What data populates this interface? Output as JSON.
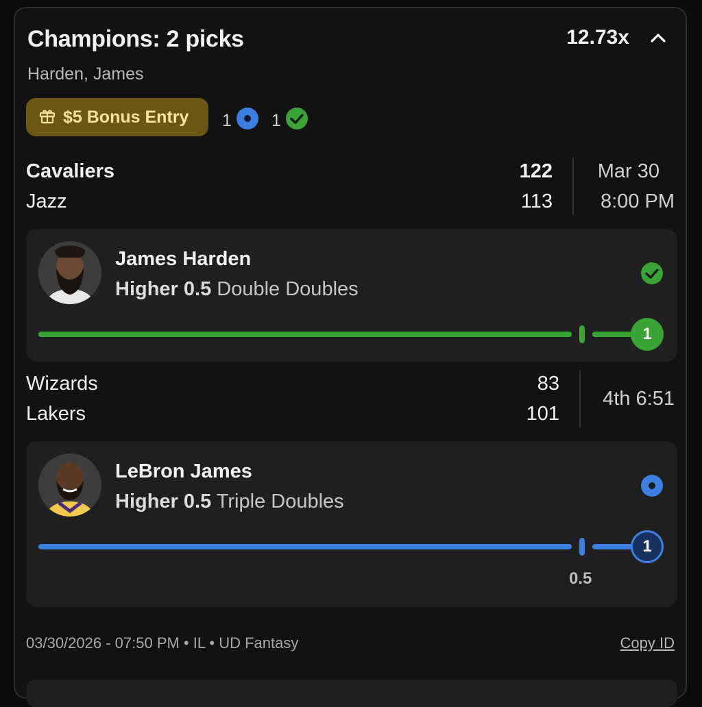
{
  "entry": {
    "title": "Champions: 2 picks",
    "multiplier": "12.73x",
    "players_summary": "Harden, James",
    "bonus_label": "$5 Bonus Entry",
    "pending_count": "1",
    "won_count": "1"
  },
  "colors": {
    "green": "#3aa335",
    "blue": "#3b7fe0",
    "bonus_bg": "#6b5713"
  },
  "games": [
    {
      "team1": "Cavaliers",
      "score1": "122",
      "team2": "Jazz",
      "score2": "113",
      "date": "Mar 30",
      "time": "8:00 PM",
      "pick": {
        "player": "James Harden",
        "direction": "Higher 0.5",
        "stat": "Double Doubles",
        "status": "won",
        "status_icon": "check-circle-icon",
        "result": "1",
        "progress": 1.0
      }
    },
    {
      "team1": "Wizards",
      "score1": "83",
      "team2": "Lakers",
      "score2": "101",
      "status": "4th 6:51",
      "pick": {
        "player": "LeBron James",
        "direction": "Higher 0.5",
        "stat": "Triple Doubles",
        "status": "live",
        "status_icon": "live-dot-icon",
        "result": "1",
        "threshold": "0.5",
        "progress": 1.0
      }
    }
  ],
  "footer": {
    "meta": "03/30/2026 - 07:50 PM • IL • UD Fantasy",
    "copy_label": "Copy ID"
  }
}
